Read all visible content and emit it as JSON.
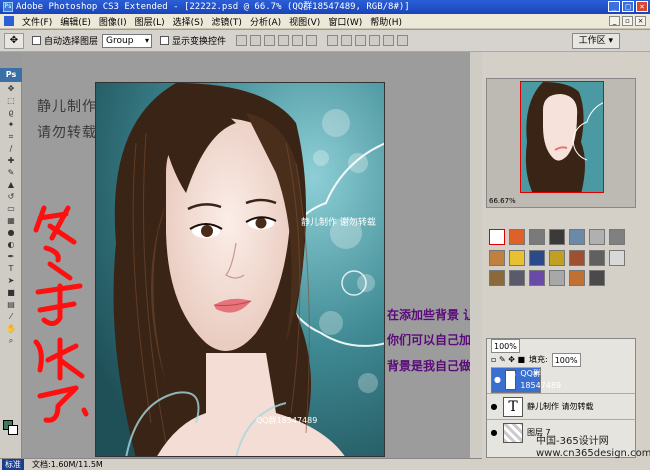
{
  "window": {
    "title": "Adobe Photoshop CS3 Extended - [22222.psd @ 66.7% (QQ群18547489, RGB/8#)]"
  },
  "menu": [
    "文件(F)",
    "编辑(E)",
    "图像(I)",
    "图层(L)",
    "选择(S)",
    "滤镜(T)",
    "分析(A)",
    "视图(V)",
    "窗口(W)",
    "帮助(H)"
  ],
  "options": {
    "auto_select": "自动选择图层",
    "group_value": "Group",
    "show_transform": "显示变换控件",
    "workspace": "工作区"
  },
  "tools": {
    "ps_label": "Ps"
  },
  "canvas": {
    "text_top": "静儿制作 谢勿转载",
    "text_bottom": "QQ群18547489"
  },
  "sidebar_text": {
    "line1": "静儿制作",
    "line2": "请勿转载"
  },
  "handwriting": "终于做完了",
  "overlay": {
    "line1": "在添加些背景  让她变的更漂亮些",
    "line2": "你们可以自己加背景  或者图片",
    "line3": "背景是我自己做的!"
  },
  "navigator": {
    "zoom": "66.67%"
  },
  "layers_panel": {
    "opacity_label": "100%",
    "fill_label": "填充:",
    "fill_value": "100%",
    "items": [
      {
        "name": "QQ群18547489",
        "thumb": "T"
      },
      {
        "name": "静儿制作 请勿转载",
        "thumb": "T"
      },
      {
        "name": "图层 7",
        "thumb": ""
      }
    ]
  },
  "status": {
    "mode": "标准",
    "doc": "文档:1.60M/11.5M"
  },
  "watermark": {
    "line1": "中国-365设计网",
    "line2": "www.cn365design.com"
  },
  "colors": {
    "teal_bg": "#3f8a94",
    "overlay_purple": "#5a0a7a",
    "selected_layer": "#3a6fd1",
    "handwriting_red": "#ff1010"
  }
}
